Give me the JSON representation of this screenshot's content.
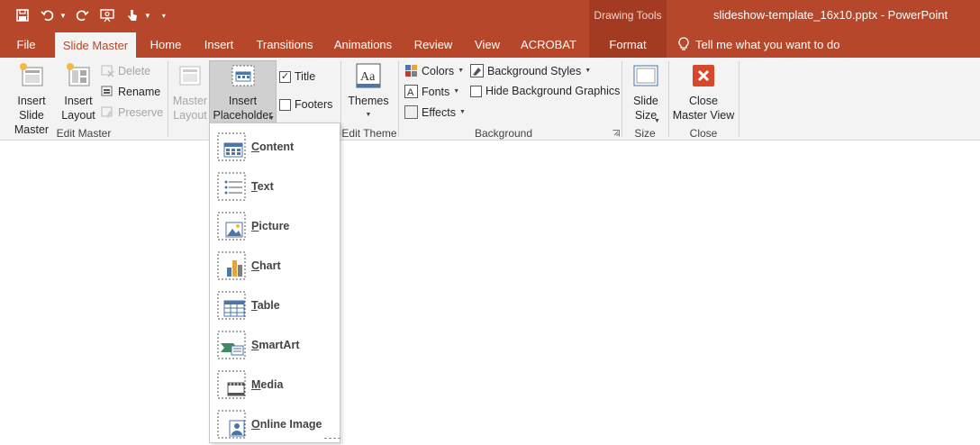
{
  "titlebar": {
    "context_tab_group": "Drawing Tools",
    "document_title": "slideshow-template_16x10.pptx  -  PowerPoint",
    "qat": [
      "save-icon",
      "undo-icon",
      "redo-icon",
      "present-from-start-icon",
      "touch-mode-icon",
      "customize-qat-icon"
    ]
  },
  "tabs": [
    {
      "label": "File"
    },
    {
      "label": "Slide Master",
      "active": true
    },
    {
      "label": "Home"
    },
    {
      "label": "Insert"
    },
    {
      "label": "Transitions"
    },
    {
      "label": "Animations"
    },
    {
      "label": "Review"
    },
    {
      "label": "View"
    },
    {
      "label": "ACROBAT"
    },
    {
      "label": "Format",
      "contextual": true
    }
  ],
  "tell_me": "Tell me what you want to do",
  "ribbon": {
    "edit_master": {
      "label": "Edit Master",
      "insert_slide_master": "Insert Slide\nMaster",
      "insert_layout": "Insert\nLayout",
      "delete": "Delete",
      "rename": "Rename",
      "preserve": "Preserve"
    },
    "master_layout": {
      "master_layout": "Master\nLayout",
      "insert_placeholder": "Insert\nPlaceholder",
      "title": "Title",
      "title_checked": true,
      "footers": "Footers",
      "footers_checked": false
    },
    "edit_theme": {
      "label": "Edit Theme",
      "themes": "Themes"
    },
    "background": {
      "label": "Background",
      "colors": "Colors",
      "fonts": "Fonts",
      "effects": "Effects",
      "background_styles": "Background Styles",
      "hide_background_graphics": "Hide Background Graphics",
      "hide_background_checked": false
    },
    "size": {
      "label": "Size",
      "slide_size": "Slide\nSize"
    },
    "close": {
      "label": "Close",
      "close_master_view": "Close\nMaster View"
    }
  },
  "placeholder_menu": [
    {
      "label": "Content",
      "icon": "content-placeholder-icon"
    },
    {
      "label": "Text",
      "icon": "text-placeholder-icon"
    },
    {
      "label": "Picture",
      "icon": "picture-placeholder-icon"
    },
    {
      "label": "Chart",
      "icon": "chart-placeholder-icon"
    },
    {
      "label": "Table",
      "icon": "table-placeholder-icon"
    },
    {
      "label": "SmartArt",
      "icon": "smartart-placeholder-icon"
    },
    {
      "label": "Media",
      "icon": "media-placeholder-icon"
    },
    {
      "label": "Online Image",
      "icon": "online-image-placeholder-icon"
    }
  ],
  "colors": {
    "accent": "#b7472a",
    "context_tab": "#a33b22",
    "ribbon_bg": "#f3f3f3",
    "close_red": "#d9472b"
  }
}
